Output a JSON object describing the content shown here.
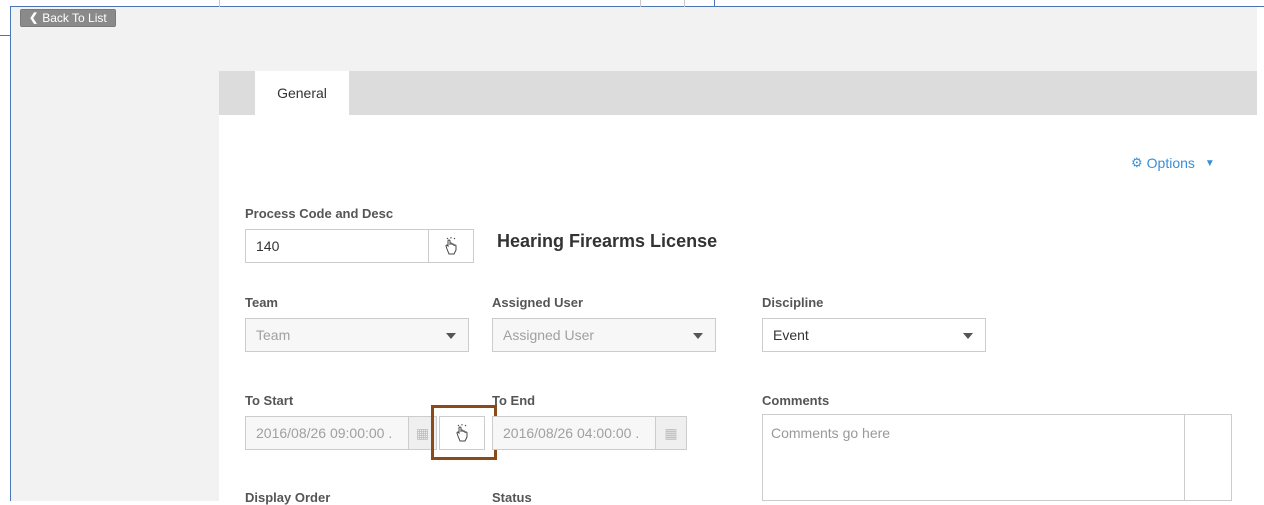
{
  "toolbar": {
    "back_label": "Back To List"
  },
  "tabs": [
    {
      "label": "General"
    }
  ],
  "options": {
    "label": "Options"
  },
  "form": {
    "process": {
      "label": "Process Code and Desc",
      "value": "140",
      "description": "Hearing Firearms License"
    },
    "team": {
      "label": "Team",
      "value": "Team"
    },
    "assigned_user": {
      "label": "Assigned User",
      "value": "Assigned User"
    },
    "discipline": {
      "label": "Discipline",
      "value": "Event"
    },
    "to_start": {
      "label": "To Start",
      "value": "2016/08/26 09:00:00 ."
    },
    "to_end": {
      "label": "To End",
      "value": "2016/08/26 04:00:00 ."
    },
    "comments": {
      "label": "Comments",
      "placeholder": "Comments go here"
    },
    "display_order": {
      "label": "Display Order"
    },
    "status": {
      "label": "Status"
    }
  },
  "colors": {
    "accent": "#3a8fd6",
    "frame": "#4a76b5",
    "highlight": "#8b4a1a",
    "button_bg": "#8a8a8a"
  },
  "icons": {
    "back": "chevron-left-icon",
    "options": "gear-icon",
    "pick": "hand-pointer-icon",
    "date": "calendar-icon",
    "dropdown": "caret-down-icon"
  }
}
